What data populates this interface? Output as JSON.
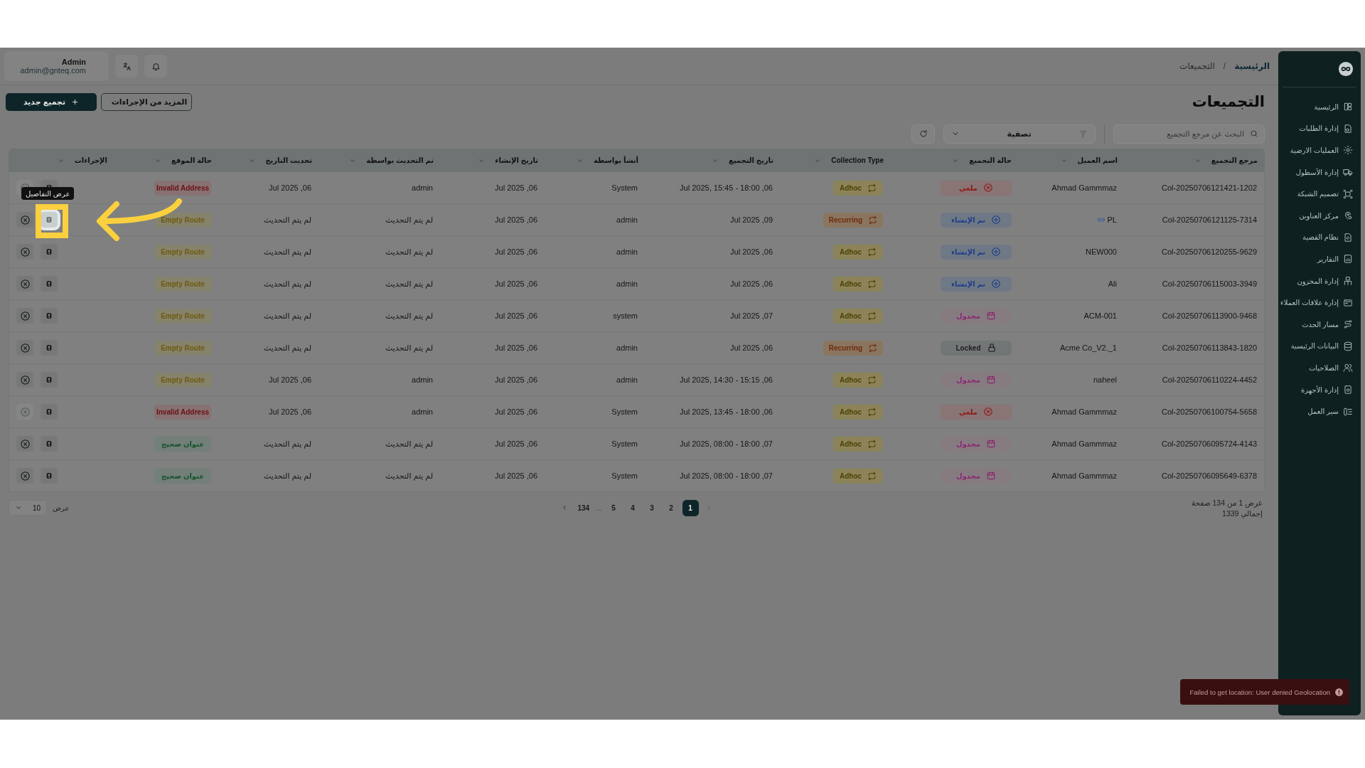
{
  "topbar": {
    "user_name": "Admin",
    "user_email": "admin@gnteq.com"
  },
  "breadcrumb": {
    "separator": "/",
    "items": [
      {
        "label": "الرئيسية",
        "current": false
      },
      {
        "label": "التجميعات",
        "current": true
      }
    ]
  },
  "page_title": "التجميعات",
  "buttons": {
    "new": "تجميع جديد",
    "more": "المزيد من الإجراءات"
  },
  "search": {
    "placeholder": "البحث عن مرجع التجميع"
  },
  "filter": {
    "label": "تصفية"
  },
  "table": {
    "columns": [
      "مرجع التجميع",
      "اسم العميل",
      "حالة التجميع",
      "Collection Type",
      "تاريخ التجميع",
      "أنشأ بواسطة",
      "تاريخ الإنشاء",
      "تم التحديث بواسطة",
      "تحديث التاريخ",
      "حالة الموقع",
      "الإجراءات"
    ],
    "rows": [
      {
        "ref": "Col-20250706121421-1202",
        "customer": "Ahmad Gammmaz",
        "customer_link": false,
        "status": {
          "label": "ملغي",
          "kind": "canceled"
        },
        "type": {
          "label": "Adhoc",
          "kind": "adhoc"
        },
        "collection_date": "Jul 2025, 15:45 - 18:00 ,06",
        "created_by": "System",
        "created_at": "Jul 2025 ,06",
        "updated_by": "admin",
        "updated_at": "Jul 2025 ,06",
        "location": {
          "label": "Invalid Address",
          "kind": "invalid"
        },
        "cancel_disabled": true,
        "highlighted": false
      },
      {
        "ref": "Col-20250706121125-7314",
        "customer": "PL",
        "customer_link": true,
        "status": {
          "label": "تم الإنشاء",
          "kind": "created"
        },
        "type": {
          "label": "Recurring",
          "kind": "recurring"
        },
        "collection_date": "Jul 2025 ,09",
        "created_by": "admin",
        "created_at": "Jul 2025 ,06",
        "updated_by": "لم يتم التحديث",
        "updated_at": "لم يتم التحديث",
        "location": {
          "label": "Empty Route",
          "kind": "empty"
        },
        "cancel_disabled": false,
        "highlighted": true
      },
      {
        "ref": "Col-20250706120255-9629",
        "customer": "NEW000",
        "customer_link": false,
        "status": {
          "label": "تم الإنشاء",
          "kind": "created"
        },
        "type": {
          "label": "Adhoc",
          "kind": "adhoc"
        },
        "collection_date": "Jul 2025 ,06",
        "created_by": "admin",
        "created_at": "Jul 2025 ,06",
        "updated_by": "لم يتم التحديث",
        "updated_at": "لم يتم التحديث",
        "location": {
          "label": "Empty Route",
          "kind": "empty"
        },
        "cancel_disabled": false,
        "highlighted": false
      },
      {
        "ref": "Col-20250706115003-3949",
        "customer": "Ali",
        "customer_link": false,
        "status": {
          "label": "تم الإنشاء",
          "kind": "created"
        },
        "type": {
          "label": "Adhoc",
          "kind": "adhoc"
        },
        "collection_date": "Jul 2025 ,06",
        "created_by": "admin",
        "created_at": "Jul 2025 ,06",
        "updated_by": "لم يتم التحديث",
        "updated_at": "لم يتم التحديث",
        "location": {
          "label": "Empty Route",
          "kind": "empty"
        },
        "cancel_disabled": false,
        "highlighted": false
      },
      {
        "ref": "Col-20250706113900-9468",
        "customer": "ACM-001",
        "customer_link": false,
        "status": {
          "label": "مجدول",
          "kind": "scheduled"
        },
        "type": {
          "label": "Adhoc",
          "kind": "adhoc"
        },
        "collection_date": "Jul 2025 ,07",
        "created_by": "system",
        "created_at": "Jul 2025 ,06",
        "updated_by": "لم يتم التحديث",
        "updated_at": "لم يتم التحديث",
        "location": {
          "label": "Empty Route",
          "kind": "empty"
        },
        "cancel_disabled": false,
        "highlighted": false
      },
      {
        "ref": "Col-20250706113843-1820",
        "customer": "Acme Co_V2._1",
        "customer_link": false,
        "status": {
          "label": "Locked",
          "kind": "locked"
        },
        "type": {
          "label": "Recurring",
          "kind": "recurring"
        },
        "collection_date": "Jul 2025 ,06",
        "created_by": "admin",
        "created_at": "Jul 2025 ,06",
        "updated_by": "لم يتم التحديث",
        "updated_at": "لم يتم التحديث",
        "location": {
          "label": "Empty Route",
          "kind": "empty"
        },
        "cancel_disabled": false,
        "highlighted": false
      },
      {
        "ref": "Col-20250706110224-4452",
        "customer": "naheel",
        "customer_link": false,
        "status": {
          "label": "مجدول",
          "kind": "scheduled"
        },
        "type": {
          "label": "Adhoc",
          "kind": "adhoc"
        },
        "collection_date": "Jul 2025, 14:30 - 15:15 ,06",
        "created_by": "admin",
        "created_at": "Jul 2025 ,06",
        "updated_by": "admin",
        "updated_at": "Jul 2025 ,06",
        "location": {
          "label": "Empty Route",
          "kind": "empty"
        },
        "cancel_disabled": false,
        "highlighted": false
      },
      {
        "ref": "Col-20250706100754-5658",
        "customer": "Ahmad Gammmaz",
        "customer_link": false,
        "status": {
          "label": "ملغي",
          "kind": "canceled"
        },
        "type": {
          "label": "Adhoc",
          "kind": "adhoc"
        },
        "collection_date": "Jul 2025, 13:45 - 18:00 ,06",
        "created_by": "System",
        "created_at": "Jul 2025 ,06",
        "updated_by": "admin",
        "updated_at": "Jul 2025 ,06",
        "location": {
          "label": "Invalid Address",
          "kind": "invalid"
        },
        "cancel_disabled": true,
        "highlighted": false
      },
      {
        "ref": "Col-20250706095724-4143",
        "customer": "Ahmad Gammmaz",
        "customer_link": false,
        "status": {
          "label": "مجدول",
          "kind": "scheduled"
        },
        "type": {
          "label": "Adhoc",
          "kind": "adhoc"
        },
        "collection_date": "Jul 2025, 08:00 - 18:00 ,07",
        "created_by": "System",
        "created_at": "Jul 2025 ,06",
        "updated_by": "لم يتم التحديث",
        "updated_at": "لم يتم التحديث",
        "location": {
          "label": "عنوان صحيح",
          "kind": "valid"
        },
        "cancel_disabled": false,
        "highlighted": false
      },
      {
        "ref": "Col-20250706095649-6378",
        "customer": "Ahmad Gammmaz",
        "customer_link": false,
        "status": {
          "label": "مجدول",
          "kind": "scheduled"
        },
        "type": {
          "label": "Adhoc",
          "kind": "adhoc"
        },
        "collection_date": "Jul 2025, 08:00 - 18:00 ,07",
        "created_by": "System",
        "created_at": "Jul 2025 ,06",
        "updated_by": "لم يتم التحديث",
        "updated_at": "لم يتم التحديث",
        "location": {
          "label": "عنوان صحيح",
          "kind": "valid"
        },
        "cancel_disabled": false,
        "highlighted": false
      }
    ]
  },
  "tooltip": "عرض التفاصيل",
  "pagination": {
    "summary": "عرض 1 من 134 صفحة",
    "total": "إجمالي 1339",
    "prev_disabled": true,
    "next_disabled": false,
    "pages": [
      {
        "label": "1",
        "kind": "page",
        "selected": true
      },
      {
        "label": "2",
        "kind": "page",
        "selected": false
      },
      {
        "label": "3",
        "kind": "page",
        "selected": false
      },
      {
        "label": "4",
        "kind": "page",
        "selected": false
      },
      {
        "label": "5",
        "kind": "page",
        "selected": false
      },
      {
        "label": "...",
        "kind": "gap"
      },
      {
        "label": "134",
        "kind": "page",
        "selected": false
      }
    ],
    "size_label": "عرض",
    "size_value": "10"
  },
  "sidebar": {
    "items": [
      {
        "label": "الرئيسية"
      },
      {
        "label": "إدارة الطلبات"
      },
      {
        "label": "العمليات الارضية"
      },
      {
        "label": "إدارة الأسطول"
      },
      {
        "label": "تصميم الشبكة"
      },
      {
        "label": "مركز العناوين"
      },
      {
        "label": "نظام القضية"
      },
      {
        "label": "التقارير"
      },
      {
        "label": "إدارة المخزون"
      },
      {
        "label": "إدارة علاقات العملاء"
      },
      {
        "label": "مسار الحدث"
      },
      {
        "label": "البيانات الرئيسية"
      },
      {
        "label": "الصلاحيات"
      },
      {
        "label": "إدارة الأجهزة"
      },
      {
        "label": "سير العمل"
      }
    ]
  },
  "toast": {
    "message": "Failed to get location: User denied Geolocation"
  }
}
